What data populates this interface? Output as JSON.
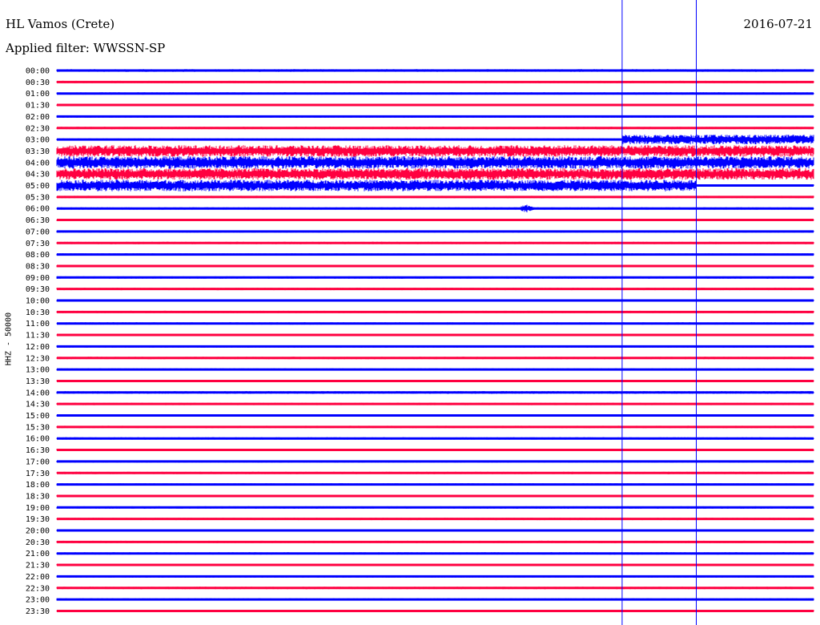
{
  "header": {
    "station_title": "HL Vamos (Crete)",
    "filter_line": "Applied filter: WWSSN-SP",
    "date": "2016-07-21"
  },
  "channel_label": "HHZ - 50000",
  "colors": {
    "trace_even": "#0000ff",
    "trace_odd": "#ff0040",
    "marker": "#0000ff",
    "background": "#ffffff"
  },
  "chart_data": {
    "type": "line",
    "title": "HL Vamos (Crete)",
    "subtitle": "Applied filter: WWSSN-SP",
    "ylabel": "HHZ - 50000",
    "xlabel": "",
    "rows": [
      {
        "label": "00:00",
        "amplitude": 0.14
      },
      {
        "label": "00:30",
        "amplitude": 0.12
      },
      {
        "label": "01:00",
        "amplitude": 0.12
      },
      {
        "label": "01:30",
        "amplitude": 0.12
      },
      {
        "label": "02:00",
        "amplitude": 0.12
      },
      {
        "label": "02:30",
        "amplitude": 0.12
      },
      {
        "label": "03:00",
        "amplitude": 0.12,
        "late_amplitude": 0.5,
        "late_start": 0.747
      },
      {
        "label": "03:30",
        "amplitude": 0.6
      },
      {
        "label": "04:00",
        "amplitude": 0.65
      },
      {
        "label": "04:30",
        "amplitude": 0.6
      },
      {
        "label": "05:00",
        "amplitude": 0.6,
        "late_amplitude": 0.12,
        "late_start": 0.845
      },
      {
        "label": "05:30",
        "amplitude": 0.12
      },
      {
        "label": "06:00",
        "amplitude": 0.12,
        "event_position": 0.62,
        "event_amplitude": 0.45
      },
      {
        "label": "06:30",
        "amplitude": 0.12
      },
      {
        "label": "07:00",
        "amplitude": 0.12
      },
      {
        "label": "07:30",
        "amplitude": 0.12
      },
      {
        "label": "08:00",
        "amplitude": 0.12
      },
      {
        "label": "08:30",
        "amplitude": 0.12
      },
      {
        "label": "09:00",
        "amplitude": 0.12
      },
      {
        "label": "09:30",
        "amplitude": 0.12
      },
      {
        "label": "10:00",
        "amplitude": 0.12
      },
      {
        "label": "10:30",
        "amplitude": 0.12
      },
      {
        "label": "11:00",
        "amplitude": 0.12
      },
      {
        "label": "11:30",
        "amplitude": 0.12
      },
      {
        "label": "12:00",
        "amplitude": 0.12
      },
      {
        "label": "12:30",
        "amplitude": 0.12
      },
      {
        "label": "13:00",
        "amplitude": 0.12
      },
      {
        "label": "13:30",
        "amplitude": 0.12
      },
      {
        "label": "14:00",
        "amplitude": 0.14
      },
      {
        "label": "14:30",
        "amplitude": 0.12
      },
      {
        "label": "15:00",
        "amplitude": 0.12
      },
      {
        "label": "15:30",
        "amplitude": 0.12
      },
      {
        "label": "16:00",
        "amplitude": 0.12
      },
      {
        "label": "16:30",
        "amplitude": 0.12
      },
      {
        "label": "17:00",
        "amplitude": 0.12
      },
      {
        "label": "17:30",
        "amplitude": 0.12
      },
      {
        "label": "18:00",
        "amplitude": 0.12
      },
      {
        "label": "18:30",
        "amplitude": 0.12
      },
      {
        "label": "19:00",
        "amplitude": 0.12
      },
      {
        "label": "19:30",
        "amplitude": 0.12
      },
      {
        "label": "20:00",
        "amplitude": 0.12
      },
      {
        "label": "20:30",
        "amplitude": 0.12
      },
      {
        "label": "21:00",
        "amplitude": 0.12
      },
      {
        "label": "21:30",
        "amplitude": 0.12
      },
      {
        "label": "22:00",
        "amplitude": 0.12
      },
      {
        "label": "22:30",
        "amplitude": 0.12
      },
      {
        "label": "23:00",
        "amplitude": 0.12
      },
      {
        "label": "23:30",
        "amplitude": 0.12
      }
    ],
    "markers": [
      0.747,
      0.845
    ],
    "grid": false,
    "legend": "none"
  }
}
